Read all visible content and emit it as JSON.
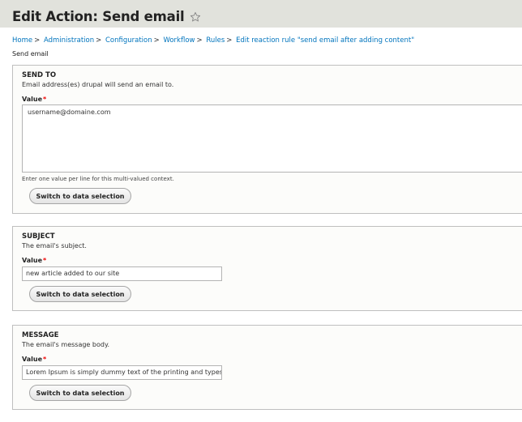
{
  "page": {
    "title": "Edit Action: Send email",
    "subheading": "Send email"
  },
  "breadcrumb": {
    "separator": ">",
    "items": [
      "Home",
      "Administration",
      "Configuration",
      "Workflow",
      "Rules",
      "Edit reaction rule \"send email after adding content\""
    ]
  },
  "send_to": {
    "title": "SEND TO",
    "description": "Email address(es) drupal will send an email to.",
    "label": "Value",
    "required_mark": "*",
    "value": "username@domaine.com",
    "help": "Enter one value per line for this multi-valued context.",
    "button": "Switch to data selection"
  },
  "subject": {
    "title": "SUBJECT",
    "description": "The email's subject.",
    "label": "Value",
    "required_mark": "*",
    "value": "new article added to our site",
    "button": "Switch to data selection"
  },
  "message": {
    "title": "MESSAGE",
    "description": "The email's message body.",
    "label": "Value",
    "required_mark": "*",
    "value": "Lorem Ipsum is simply dummy text of the printing and typesetting industry.",
    "button": "Switch to data selection"
  },
  "colors": {
    "header_bg": "#e1e2dc",
    "link": "#0074bd",
    "required": "#ee0000",
    "panel_bg": "#fcfcfa"
  },
  "icons": {
    "title_star": "star-outline-icon"
  }
}
